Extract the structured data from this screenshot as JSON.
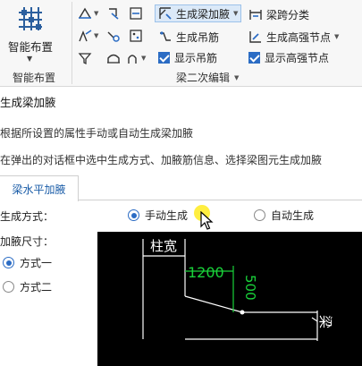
{
  "ribbon": {
    "big_button": {
      "label": "智能布置",
      "icon": "grid-layout-icon"
    },
    "group1_label": "智能布置",
    "group2_label": "梁二次编辑",
    "tools": {
      "gen_haunch": "生成梁加腋",
      "gen_hanger": "生成吊筋",
      "show_hanger": "显示吊筋",
      "span_classify": "梁跨分类",
      "gen_strong_node": "生成高强节点",
      "show_strong_node": "显示高强节点"
    },
    "colors": {
      "accent": "#2b6cc4",
      "active_bg": "#dbe9f8"
    }
  },
  "dialog": {
    "title": "生成梁加腋",
    "desc1": "根据所设置的属性手动或自动生成梁加腋",
    "desc2": "在弹出的对话框中选中生成方式、加腋筋信息、选择梁图元生成加腋",
    "tab": "梁水平加腋",
    "gen_mode_label": "生成方式：",
    "mode_manual": "手动生成",
    "mode_auto": "自动生成",
    "size_label": "加腋尺寸：",
    "option1": "方式一",
    "option2": "方式二",
    "diagram": {
      "col_width": "柱宽",
      "dim_1200": "1200",
      "dim_500": "500",
      "beam_label": "梁"
    }
  }
}
